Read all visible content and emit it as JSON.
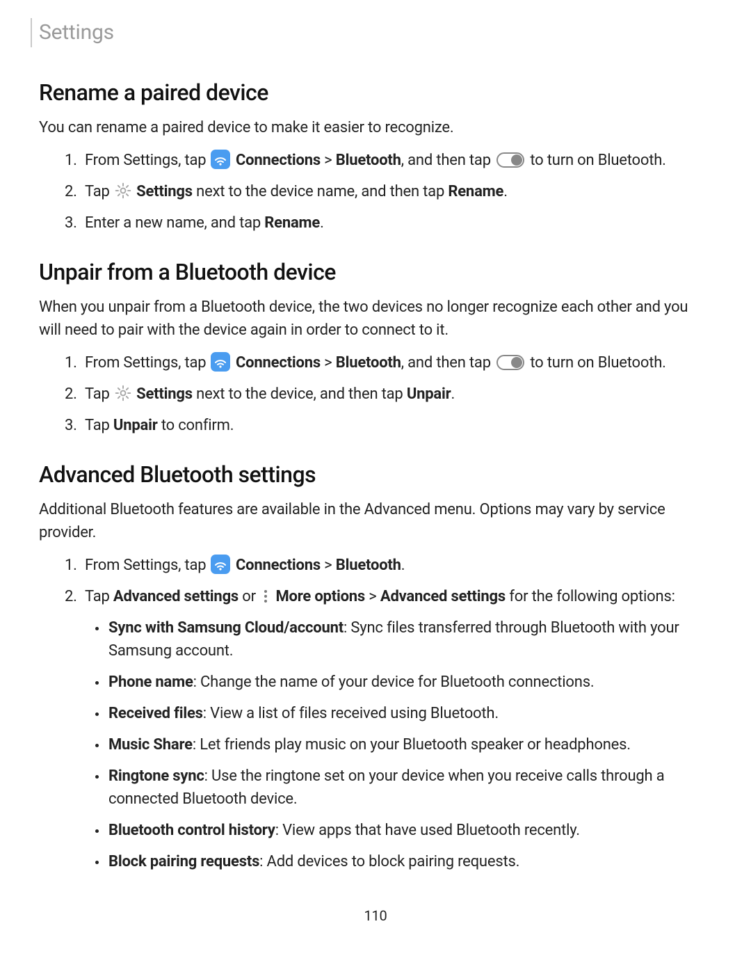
{
  "header": {
    "title": "Settings"
  },
  "section1": {
    "heading": "Rename a paired device",
    "intro": "You can rename a paired device to make it easier to recognize.",
    "step1_a": "From Settings, tap ",
    "step1_conn": "Connections",
    "step1_sep": " > ",
    "step1_bt": "Bluetooth",
    "step1_b": ", and then tap ",
    "step1_c": " to turn on Bluetooth.",
    "step2_a": "Tap ",
    "step2_settings": "Settings",
    "step2_b": " next to the device name, and then tap ",
    "step2_rename": "Rename",
    "step2_c": ".",
    "step3_a": "Enter a new name, and tap ",
    "step3_rename": "Rename",
    "step3_b": "."
  },
  "section2": {
    "heading": "Unpair from a Bluetooth device",
    "intro": "When you unpair from a Bluetooth device, the two devices no longer recognize each other and you will need to pair with the device again in order to connect to it.",
    "step1_a": "From Settings, tap ",
    "step1_conn": "Connections",
    "step1_sep": " > ",
    "step1_bt": "Bluetooth",
    "step1_b": ", and then tap ",
    "step1_c": " to turn on Bluetooth.",
    "step2_a": "Tap ",
    "step2_settings": "Settings",
    "step2_b": " next to the device, and then tap ",
    "step2_unpair": "Unpair",
    "step2_c": ".",
    "step3_a": "Tap ",
    "step3_unpair": "Unpair",
    "step3_b": " to confirm."
  },
  "section3": {
    "heading": "Advanced Bluetooth settings",
    "intro": "Additional Bluetooth features are available in the Advanced menu. Options may vary by service provider.",
    "step1_a": "From Settings, tap ",
    "step1_conn": "Connections",
    "step1_sep": " > ",
    "step1_bt": "Bluetooth",
    "step1_b": ".",
    "step2_a": "Tap ",
    "step2_adv": "Advanced settings",
    "step2_or": " or ",
    "step2_more": "More options",
    "step2_sep": " > ",
    "step2_adv2": "Advanced settings",
    "step2_b": " for the following options:",
    "bullets": {
      "b1_t": "Sync with Samsung Cloud/account",
      "b1_d": ": Sync files transferred through Bluetooth with your Samsung account.",
      "b2_t": "Phone name",
      "b2_d": ": Change the name of your device for Bluetooth connections.",
      "b3_t": "Received files",
      "b3_d": ": View a list of files received using Bluetooth.",
      "b4_t": "Music Share",
      "b4_d": ": Let friends play music on your Bluetooth speaker or headphones.",
      "b5_t": "Ringtone sync",
      "b5_d": ": Use the ringtone set on your device when you receive calls through a connected Bluetooth device.",
      "b6_t": "Bluetooth control history",
      "b6_d": ": View apps that have used Bluetooth recently.",
      "b7_t": "Block pairing requests",
      "b7_d": ": Add devices to block pairing requests."
    }
  },
  "footer": {
    "page": "110"
  }
}
